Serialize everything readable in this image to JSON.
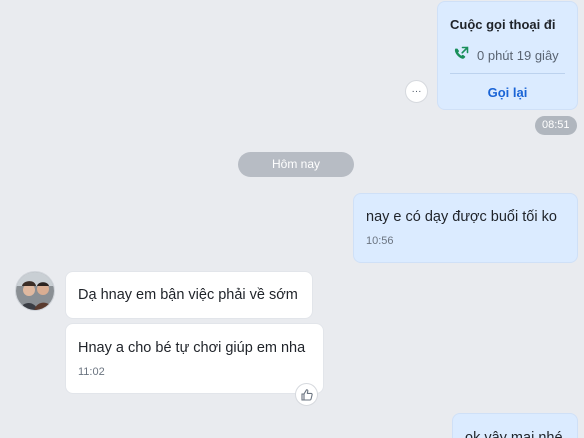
{
  "call_card": {
    "title": "Cuộc gọi thoại đi",
    "duration": "0 phút 19 giây",
    "callback_label": "Gọi lại",
    "time": "08:51"
  },
  "more_label": "···",
  "date_separator": "Hôm nay",
  "messages": [
    {
      "direction": "out",
      "text": "nay e có dạy được buổi tối ko",
      "time": "10:56"
    },
    {
      "direction": "in",
      "text": "Dạ hnay em bận việc phải về sớm"
    },
    {
      "direction": "in",
      "text": "Hnay a cho bé tự chơi giúp em nha",
      "time": "11:02"
    },
    {
      "direction": "out",
      "text": "ok vậy mai nhé"
    }
  ],
  "colors": {
    "background": "#e9ebef",
    "outgoing_bubble": "#dbebff",
    "incoming_bubble": "#ffffff",
    "accent": "#1a64d6",
    "call_icon": "#1a8f5a"
  },
  "icons": {
    "call_out": "phone-outgoing-icon",
    "more": "more-icon",
    "reaction": "thumbs-up-icon"
  }
}
